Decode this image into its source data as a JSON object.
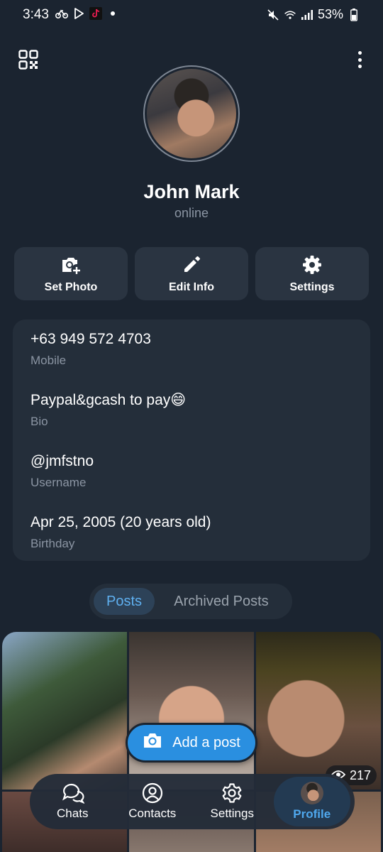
{
  "status_bar": {
    "time": "3:43",
    "battery": "53%",
    "icons": [
      "bicycle-icon",
      "play-store-icon",
      "tiktok-icon",
      "notification-dot",
      "mute-icon",
      "wifi-icon",
      "signal-icon",
      "battery-icon"
    ]
  },
  "header": {
    "qr_icon": "qr-code-icon",
    "more_icon": "more-vertical-icon"
  },
  "profile": {
    "name": "John Mark",
    "status": "online"
  },
  "actions": [
    {
      "label": "Set Photo",
      "icon": "camera-add-icon"
    },
    {
      "label": "Edit Info",
      "icon": "pencil-icon"
    },
    {
      "label": "Settings",
      "icon": "gear-icon"
    }
  ],
  "info": [
    {
      "value": "+63 949 572 4703",
      "label": "Mobile"
    },
    {
      "value": "Paypal&gcash to pay😄",
      "label": "Bio"
    },
    {
      "value": "@jmfstno",
      "label": "Username"
    },
    {
      "value": "Apr 25, 2005 (20 years old)",
      "label": "Birthday"
    }
  ],
  "tabs": {
    "posts": "Posts",
    "archived": "Archived Posts",
    "selected": "Posts"
  },
  "posts": {
    "views": "217"
  },
  "fab": {
    "label": "Add a post"
  },
  "nav": [
    {
      "label": "Chats",
      "icon": "chat-bubbles-icon"
    },
    {
      "label": "Contacts",
      "icon": "person-circle-icon"
    },
    {
      "label": "Settings",
      "icon": "gear-icon"
    },
    {
      "label": "Profile",
      "icon": "profile-avatar"
    }
  ],
  "colors": {
    "background": "#1b2430",
    "card": "#242e3a",
    "accent": "#2a8fe0",
    "active_nav_text": "#4fa8ee"
  }
}
